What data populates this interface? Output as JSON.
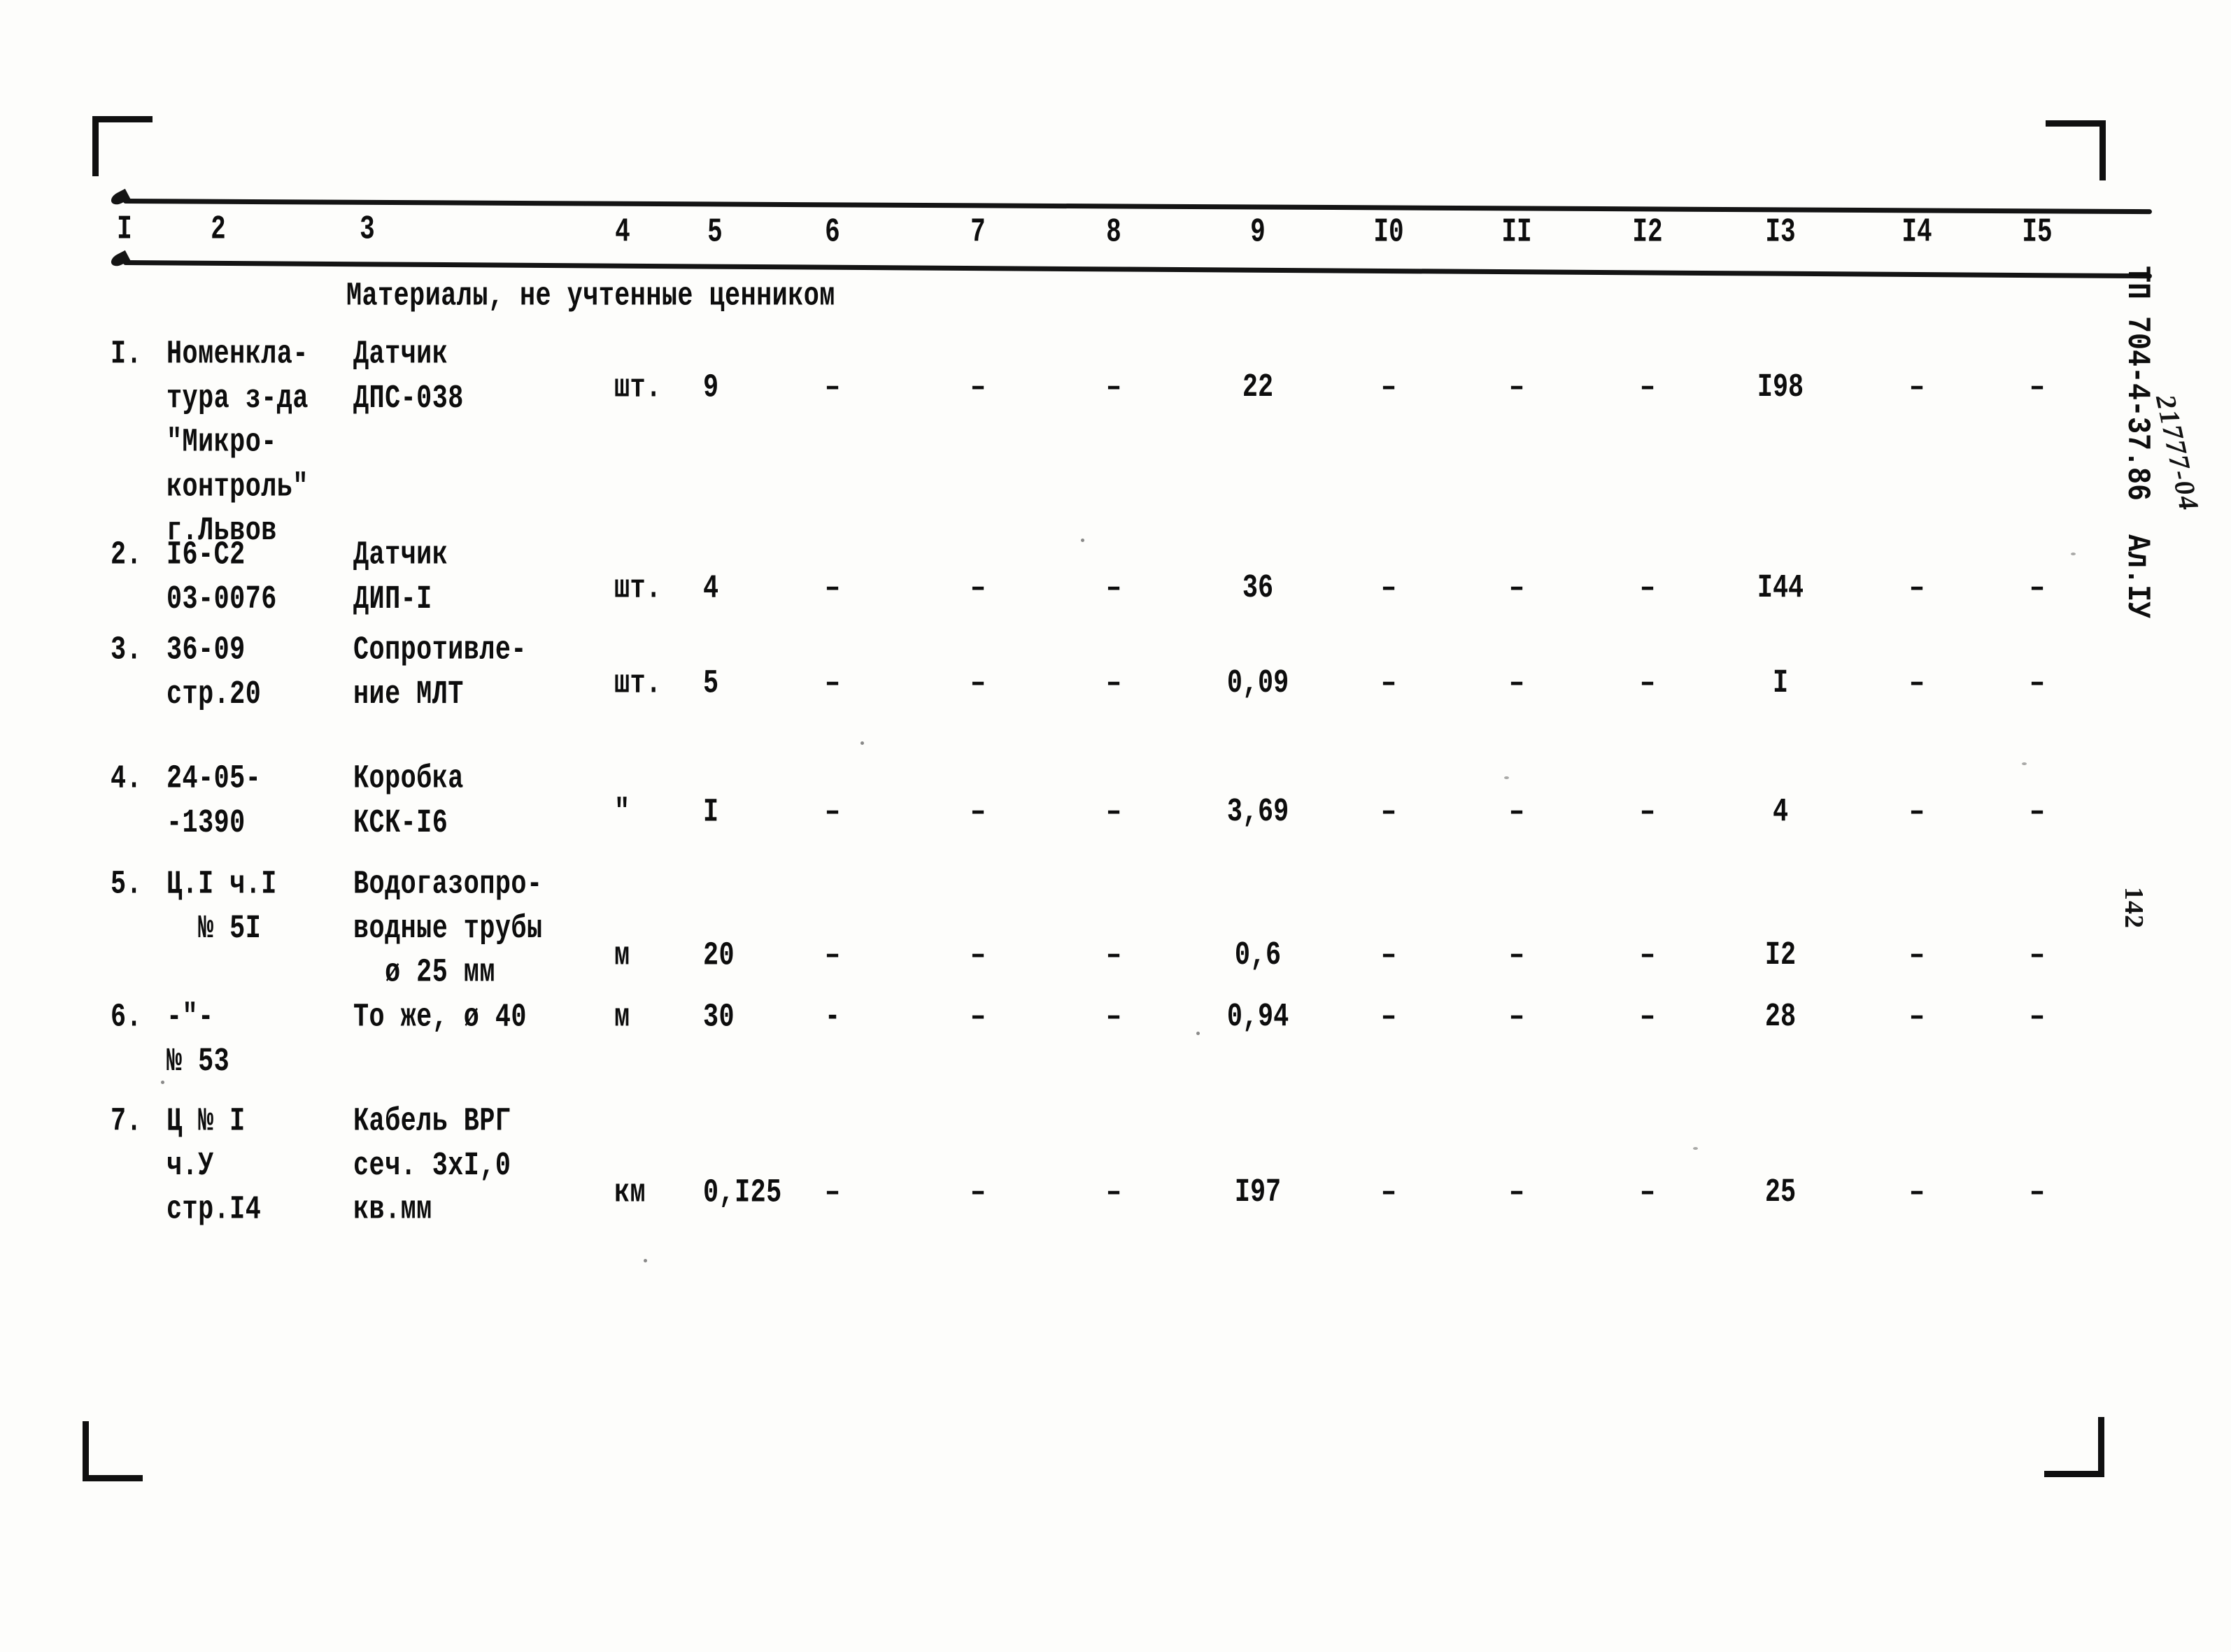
{
  "document": {
    "section_title": "Материалы, не учтенные ценником",
    "column_numbers": [
      "I",
      "2",
      "3",
      "4",
      "5",
      "6",
      "7",
      "8",
      "9",
      "I0",
      "II",
      "I2",
      "I3",
      "I4",
      "I5"
    ],
    "margin": {
      "stamp": "ТП 704-4-37.86  Ал.IУ",
      "handwritten_code": "21777-04",
      "page_number": "142"
    }
  },
  "table": {
    "rows": [
      {
        "num": "I.",
        "code": "Номенкла-\nтура з-да\n\"Микро-\nконтроль\"\nг.Львов",
        "name": "Датчик\nДПС-038",
        "unit": "шт.",
        "qty": "9",
        "c6": "–",
        "c7": "–",
        "c8": "–",
        "c9": "22",
        "c10": "–",
        "c11": "–",
        "c12": "–",
        "c13": "I98",
        "c14": "–",
        "c15": "–"
      },
      {
        "num": "2.",
        "code": "I6-С2\n03-0076",
        "name": "Датчик\nДИП-I",
        "unit": "шт.",
        "qty": "4",
        "c6": "–",
        "c7": "–",
        "c8": "–",
        "c9": "36",
        "c10": "–",
        "c11": "–",
        "c12": "–",
        "c13": "I44",
        "c14": "–",
        "c15": "–"
      },
      {
        "num": "3.",
        "code": "36-09\nстр.20",
        "name": "Сопротивле-\nние МЛТ",
        "unit": "шт.",
        "qty": "5",
        "c6": "–",
        "c7": "–",
        "c8": "–",
        "c9": "0,09",
        "c10": "–",
        "c11": "–",
        "c12": "–",
        "c13": "I",
        "c14": "–",
        "c15": "–"
      },
      {
        "num": "4.",
        "code": "24-05-\n-1390",
        "name": "Коробка\nКСК-I6",
        "unit": "\"",
        "qty": "I",
        "c6": "–",
        "c7": "–",
        "c8": "–",
        "c9": "3,69",
        "c10": "–",
        "c11": "–",
        "c12": "–",
        "c13": "4",
        "c14": "–",
        "c15": "–"
      },
      {
        "num": "5.",
        "code": "Ц.I ч.I\n  № 5I",
        "name": "Водогазопро-\nводные трубы\n  ø 25 мм",
        "unit": "м",
        "qty": "20",
        "c6": "–",
        "c7": "–",
        "c8": "–",
        "c9": "0,6",
        "c10": "–",
        "c11": "–",
        "c12": "–",
        "c13": "I2",
        "c14": "–",
        "c15": "–"
      },
      {
        "num": "6.",
        "code": "-\"-\n№ 53",
        "name": "То же, ø 40",
        "unit": "м",
        "qty": "30",
        "c6": "-",
        "c7": "–",
        "c8": "–",
        "c9": "0,94",
        "c10": "–",
        "c11": "–",
        "c12": "–",
        "c13": "28",
        "c14": "–",
        "c15": "–"
      },
      {
        "num": "7.",
        "code": "Ц № I\nч.У\nстр.I4",
        "name": "Кабель ВРГ\nсеч. 3хI,0\nкв.мм",
        "unit": "км",
        "qty": "0,I25",
        "c6": "–",
        "c7": "–",
        "c8": "–",
        "c9": "I97",
        "c10": "–",
        "c11": "–",
        "c12": "–",
        "c13": "25",
        "c14": "–",
        "c15": "–"
      }
    ]
  }
}
